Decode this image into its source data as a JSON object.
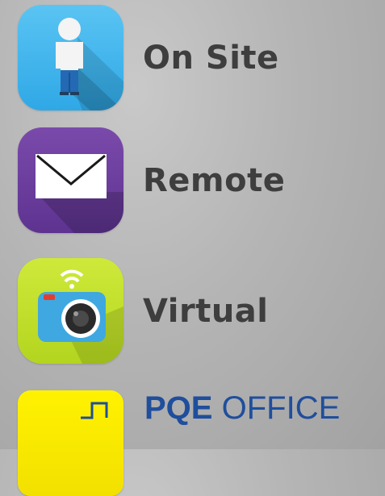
{
  "menu": {
    "items": [
      {
        "label": "On Site",
        "icon": "person-icon",
        "color": "#3fb6ee"
      },
      {
        "label": "Remote",
        "icon": "envelope-icon",
        "color": "#6a3d99"
      },
      {
        "label": "Virtual",
        "icon": "camera-icon",
        "color": "#bfe12c"
      }
    ],
    "office": {
      "brand": "PQE",
      "suffix": "OFFICE",
      "icon": "signal-icon",
      "color": "#f5e800",
      "text_color": "#1f4e9c"
    }
  }
}
